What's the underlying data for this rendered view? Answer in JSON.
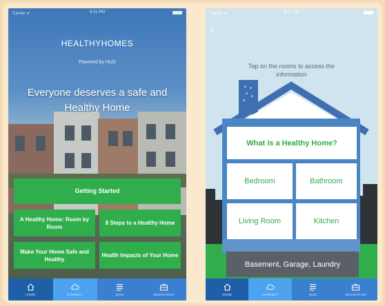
{
  "left": {
    "status": {
      "carrier": "Carrier ᯤ",
      "time": "9:11 PM"
    },
    "title": "HEALTHYHOMES",
    "subtitle": "Powered by HUD",
    "tagline": "Everyone deserves a safe and Healthy Home",
    "buttons": {
      "getting_started": "Getting Started",
      "room_by_room": "A Healthy Home: Room by Room",
      "eight_steps": "8 Steps to a Healthy Home",
      "safe_healthy": "Make Your Home Safe and Healthy",
      "health_impacts": "Health Impacts of Your Home"
    }
  },
  "right": {
    "status": {
      "carrier": "Carrier ᯤ",
      "time": "9:11 PM"
    },
    "back": "‹",
    "hint": "Tap on the rooms to access the information",
    "rooms": {
      "what_is": "What is a Healthy Home?",
      "bedroom": "Bedroom",
      "bathroom": "Bathroom",
      "living_room": "Living Room",
      "kitchen": "Kitchen",
      "basement": "Basement, Garage, Laundry"
    }
  },
  "tabs": [
    {
      "label": "HOME",
      "icon": "home-icon"
    },
    {
      "label": "CONNECT",
      "icon": "cloud-icon"
    },
    {
      "label": "QUIZ",
      "icon": "quiz-icon"
    },
    {
      "label": "RESOURCES",
      "icon": "briefcase-icon"
    }
  ],
  "colors": {
    "green": "#2fae4b",
    "tabbar": "#3a7fd0",
    "tab_active": "#1f5fa8",
    "tab_connect": "#4ea3f0",
    "roof": "#3f6fb0",
    "basement": "#5b5f66",
    "frame": "#f6dcb4"
  }
}
